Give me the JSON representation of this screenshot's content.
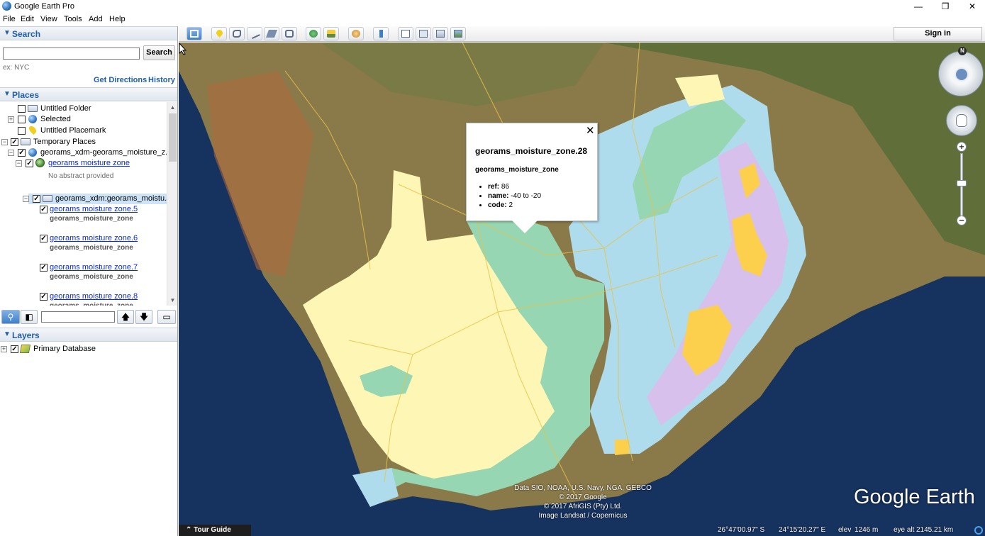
{
  "window": {
    "title": "Google Earth Pro",
    "minimize": "—",
    "restore": "❐",
    "close": "✕"
  },
  "menu": [
    "File",
    "Edit",
    "View",
    "Tools",
    "Add",
    "Help"
  ],
  "search": {
    "header": "Search",
    "input_value": "",
    "button": "Search",
    "hint": "ex: NYC",
    "get_directions": "Get Directions",
    "history": "History"
  },
  "places": {
    "header": "Places",
    "items": [
      {
        "label": "Untitled Folder"
      },
      {
        "label": "Selected"
      },
      {
        "label": "Untitled Placemark"
      },
      {
        "label": "Temporary Places"
      },
      {
        "label": "georams_xdm-georams_moisture_z..."
      },
      {
        "label": "georams moisture zone",
        "sub": "No abstract provided"
      },
      {
        "label": "georams_xdm:georams_moistu..."
      },
      {
        "label": "georams moisture zone.5",
        "sub": "georams_moisture_zone"
      },
      {
        "label": "georams moisture zone.6",
        "sub": "georams_moisture_zone"
      },
      {
        "label": "georams moisture zone.7",
        "sub": "georams_moisture_zone"
      },
      {
        "label": "georams moisture zone.8",
        "sub": "georams_moisture_zone"
      }
    ]
  },
  "layers": {
    "header": "Layers",
    "items": [
      {
        "label": "Primary Database"
      }
    ]
  },
  "toolbar": {
    "sign_in": "Sign in"
  },
  "balloon": {
    "title": "georams_moisture_zone.28",
    "subtitle": "georams_moisture_zone",
    "fields": [
      {
        "key": "ref:",
        "value": "86"
      },
      {
        "key": "name:",
        "value": "-40 to -20"
      },
      {
        "key": "code:",
        "value": "2"
      }
    ],
    "close": "✕"
  },
  "map": {
    "attribution": [
      "Data SIO, NOAA, U.S. Navy, NGA, GEBCO",
      "© 2017 Google",
      "© 2017 AfriGIS (Pty) Ltd.",
      "Image Landsat / Copernicus"
    ],
    "logo": "Google Earth",
    "tour_guide": "Tour Guide",
    "tour_guide_icon": "chevron-up-icon",
    "status": {
      "lat": "26°47'00.97\" S",
      "lon": "24°15'20.27\" E",
      "elev_label": "elev",
      "elev": "1246 m",
      "eye_alt_label": "eye alt",
      "eye_alt": "2145.21 km"
    },
    "compass_north": "N",
    "zoom_in": "+",
    "zoom_out": "−"
  },
  "colors": {
    "ocean": "#16325f",
    "land": "#8a7a4a",
    "zone_yellow": "#fdf6b4",
    "zone_green": "#96d6b2",
    "zone_blue": "#aedcec",
    "zone_purple": "#d7c0ec",
    "zone_orange": "#fccf4c",
    "road": "#e8c347",
    "link": "#0a2bd6",
    "header_text": "#1f5fa8"
  }
}
